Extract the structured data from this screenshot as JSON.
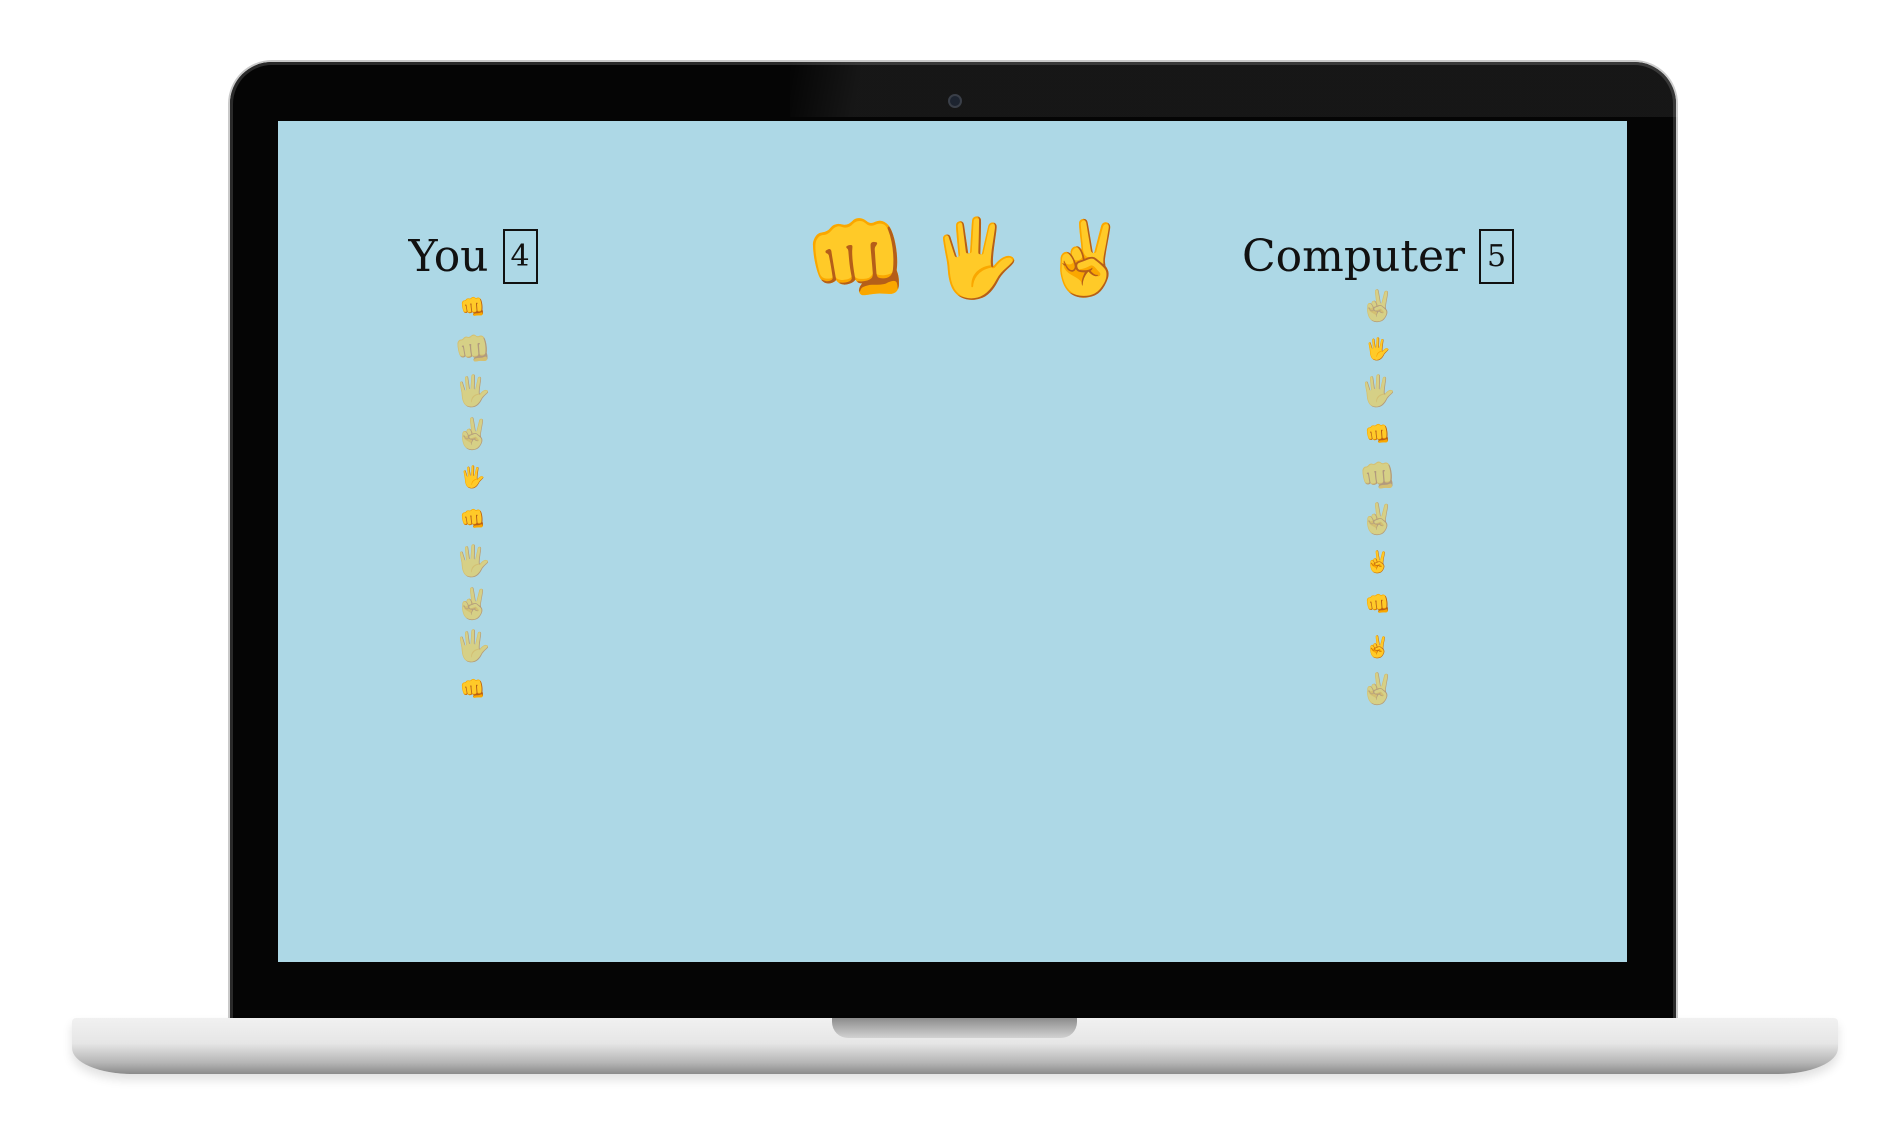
{
  "player": {
    "label": "You",
    "score": "4"
  },
  "computer": {
    "label": "Computer",
    "score": "5"
  },
  "choices": [
    {
      "id": "rock",
      "glyph": "👊",
      "icon": "fist-icon"
    },
    {
      "id": "paper",
      "glyph": "🖐",
      "icon": "hand-icon"
    },
    {
      "id": "scissors",
      "glyph": "✌",
      "icon": "victory-hand-icon"
    }
  ],
  "player_history": [
    {
      "glyph": "👊",
      "style": "small"
    },
    {
      "glyph": "👊",
      "style": "big"
    },
    {
      "glyph": "🖐",
      "style": "big"
    },
    {
      "glyph": "✌",
      "style": "big"
    },
    {
      "glyph": "🖐",
      "style": "small"
    },
    {
      "glyph": "👊",
      "style": "small"
    },
    {
      "glyph": "🖐",
      "style": "big"
    },
    {
      "glyph": "✌",
      "style": "big"
    },
    {
      "glyph": "🖐",
      "style": "big"
    },
    {
      "glyph": "👊",
      "style": "small"
    }
  ],
  "computer_history": [
    {
      "glyph": "✌",
      "style": "big"
    },
    {
      "glyph": "🖐",
      "style": "small"
    },
    {
      "glyph": "🖐",
      "style": "big"
    },
    {
      "glyph": "👊",
      "style": "small"
    },
    {
      "glyph": "👊",
      "style": "big"
    },
    {
      "glyph": "✌",
      "style": "big"
    },
    {
      "glyph": "✌",
      "style": "small"
    },
    {
      "glyph": "👊",
      "style": "small"
    },
    {
      "glyph": "✌",
      "style": "small"
    },
    {
      "glyph": "✌",
      "style": "big"
    }
  ],
  "colors": {
    "screen_background": "#add8e6",
    "text": "#111111"
  }
}
